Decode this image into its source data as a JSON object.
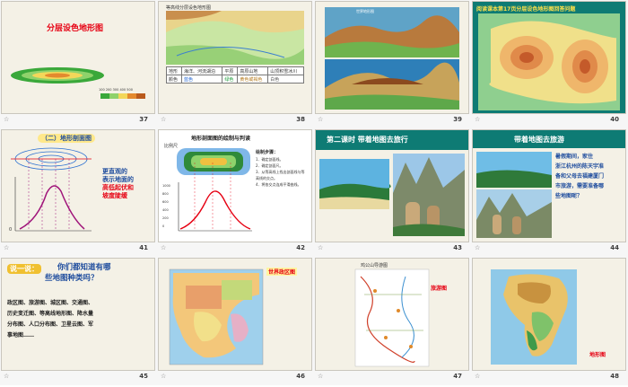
{
  "footer": {
    "marker": "☆"
  },
  "slides": [
    {
      "num": "37",
      "title": "分层设色地形图",
      "legend_ticks": [
        "100",
        "200",
        "300",
        "400",
        "500"
      ]
    },
    {
      "num": "38",
      "title": "等高线分层设色地形图",
      "table": [
        [
          "地形",
          "海洋、河流湖泊",
          "平原",
          "高原山地",
          "山顶积雪冰川"
        ],
        [
          "颜色",
          "蓝色",
          "绿色",
          "黄色或褐色",
          "白色"
        ]
      ]
    },
    {
      "num": "39",
      "caption": "世界地形图"
    },
    {
      "num": "40",
      "title": "阅读课本第17页分层设色地形图回答问题"
    },
    {
      "num": "41",
      "title": "（二）地形剖面图",
      "text_lines": [
        "更直观的",
        "表示地面的",
        "高低起伏和",
        "坡度陡缓"
      ],
      "tick_label": "0"
    },
    {
      "num": "42",
      "title": "地形剖面图的绘制与判读",
      "scale_label": "比例尺",
      "steps_title": "绘制步骤：",
      "steps": [
        "1．确定剖面线。",
        "2．确定剖面尺。",
        "3．从等高线上找出剖面线与等高线的交点。",
        "4．将各交点连成平滑曲线。"
      ],
      "y_ticks": [
        "1000",
        "800",
        "600",
        "400",
        "200",
        "0"
      ]
    },
    {
      "num": "43",
      "title": "第二课时    带着地图去旅行"
    },
    {
      "num": "44",
      "title": "带着地图去旅游",
      "text_lines": [
        "暑假期间，家住",
        "浙江杭州的陈天宇准",
        "备和父母去福建厦门",
        "市旅游，需要准备哪",
        "些地图呢？"
      ]
    },
    {
      "num": "45",
      "question_tag": "说一说：",
      "question_lines": [
        "你们都知道有哪",
        "些地图种类吗？"
      ],
      "list_lines": [
        "政区图、旅游图、城区图、交通图、",
        "历史变迁图、等高线地形图、降水量",
        "分布图、人口分布图、卫星云图、军",
        "事地图……"
      ]
    },
    {
      "num": "46",
      "label": "世界政区图"
    },
    {
      "num": "47",
      "title": "鸡公山导游图",
      "label": "旅游图"
    },
    {
      "num": "48",
      "label": "地形图"
    }
  ],
  "colors": {
    "accent_red": "#e60012",
    "accent_blue": "#1f4d9e",
    "dark_teal": "#0e7b74"
  }
}
